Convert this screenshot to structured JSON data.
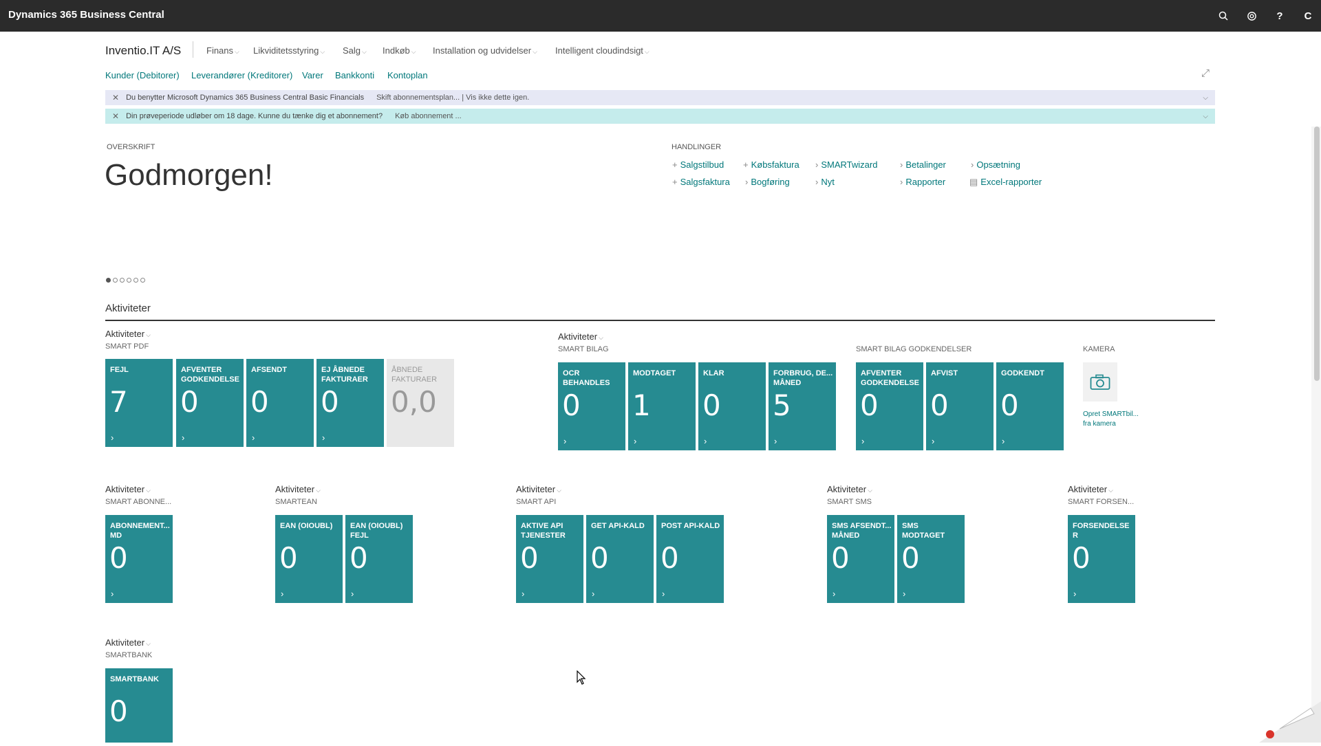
{
  "app": {
    "title": "Dynamics 365 Business Central"
  },
  "topbar_icons": [
    {
      "name": "search-icon",
      "glyph": "⌕"
    },
    {
      "name": "settings-icon",
      "glyph": "⚙"
    },
    {
      "name": "help-icon",
      "glyph": "?"
    },
    {
      "name": "user-avatar",
      "glyph": "C"
    }
  ],
  "header": {
    "company": "Inventio.IT A/S",
    "menus": [
      "Finans",
      "Likviditetsstyring",
      "Salg",
      "Indkøb",
      "Installation og udvidelser",
      "Intelligent cloudindsigt"
    ],
    "navlinks": [
      "Kunder (Debitorer)",
      "Leverandører (Kreditorer)",
      "Varer",
      "Bankkonti",
      "Kontoplan"
    ]
  },
  "notifications": [
    {
      "text": "Du benytter Microsoft Dynamics 365 Business Central Basic Financials",
      "link": "Skift abonnementsplan... | Vis ikke dette igen."
    },
    {
      "text": "Din prøveperiode udløber om 18 dage. Kunne du tænke dig et abonnement?",
      "link": "Køb abonnement ..."
    }
  ],
  "headline": {
    "caption": "OVERSKRIFT",
    "greeting": "Godmorgen!"
  },
  "actions": {
    "caption": "HANDLINGER",
    "items": [
      {
        "icon": "+",
        "label": "Salgstilbud"
      },
      {
        "icon": "+",
        "label": "Salgsfaktura"
      },
      {
        "icon": "+",
        "label": "Købsfaktura"
      },
      {
        "icon": "›",
        "label": "Bogføring"
      },
      {
        "icon": "›",
        "label": "SMARTwizard"
      },
      {
        "icon": "›",
        "label": "Nyt"
      },
      {
        "icon": "›",
        "label": "Betalinger"
      },
      {
        "icon": "›",
        "label": "Rapporter"
      },
      {
        "icon": "›",
        "label": "Opsætning"
      },
      {
        "icon": "▤",
        "label": "Excel-rapporter"
      }
    ]
  },
  "activities": {
    "title": "Aktiviteter",
    "group_label": "Aktiviteter",
    "groups": [
      {
        "sub": "SMART PDF",
        "tiles": [
          {
            "label": "FEJL",
            "value": "7"
          },
          {
            "label": "AFVENTER GODKENDELSE",
            "value": "0"
          },
          {
            "label": "AFSENDT",
            "value": "0"
          },
          {
            "label": "EJ ÅBNEDE FAKTURAER",
            "value": "0"
          },
          {
            "label": "ÅBNEDE FAKTURAER",
            "value": "0,0"
          }
        ]
      },
      {
        "sub": "SMART BILAG",
        "tiles": [
          {
            "label": "OCR BEHANDLES",
            "value": "0"
          },
          {
            "label": "MODTAGET",
            "value": "1"
          },
          {
            "label": "KLAR",
            "value": "0"
          },
          {
            "label": "FORBRUG, DE... MÅNED",
            "value": "5"
          }
        ]
      },
      {
        "sub": "SMART BILAG GODKENDELSER",
        "tiles": [
          {
            "label": "AFVENTER GODKENDELSE",
            "value": "0"
          },
          {
            "label": "AFVIST",
            "value": "0"
          },
          {
            "label": "GODKENDT",
            "value": "0"
          }
        ]
      },
      {
        "sub": "KAMERA",
        "action": "Opret SMARTbil... fra kamera"
      },
      {
        "sub": "SMART ABONNE...",
        "tiles": [
          {
            "label": "ABONNEMENT... MD",
            "value": "0"
          }
        ]
      },
      {
        "sub": "SMARTEAN",
        "tiles": [
          {
            "label": "EAN (OIOUBL)",
            "value": "0"
          },
          {
            "label": "EAN (OIOUBL) FEJL",
            "value": "0"
          }
        ]
      },
      {
        "sub": "SMART API",
        "tiles": [
          {
            "label": "AKTIVE API TJENESTER",
            "value": "0"
          },
          {
            "label": "GET API-KALD",
            "value": "0"
          },
          {
            "label": "POST API-KALD",
            "value": "0"
          }
        ]
      },
      {
        "sub": "SMART SMS",
        "tiles": [
          {
            "label": "SMS AFSENDT... MÅNED",
            "value": "0"
          },
          {
            "label": "SMS MODTAGET",
            "value": "0"
          }
        ]
      },
      {
        "sub": "SMART FORSEN...",
        "tiles": [
          {
            "label": "FORSENDELSE R",
            "value": "0"
          }
        ]
      },
      {
        "sub": "SMARTBANK",
        "tiles": [
          {
            "label": "SMARTBANK",
            "value": "0"
          }
        ]
      }
    ]
  },
  "colors": {
    "topbar": "#2b2b2b",
    "accent": "#00777a",
    "tile": "#268b91",
    "notice1": "#e6e8f5",
    "notice2": "#c5ecec"
  }
}
